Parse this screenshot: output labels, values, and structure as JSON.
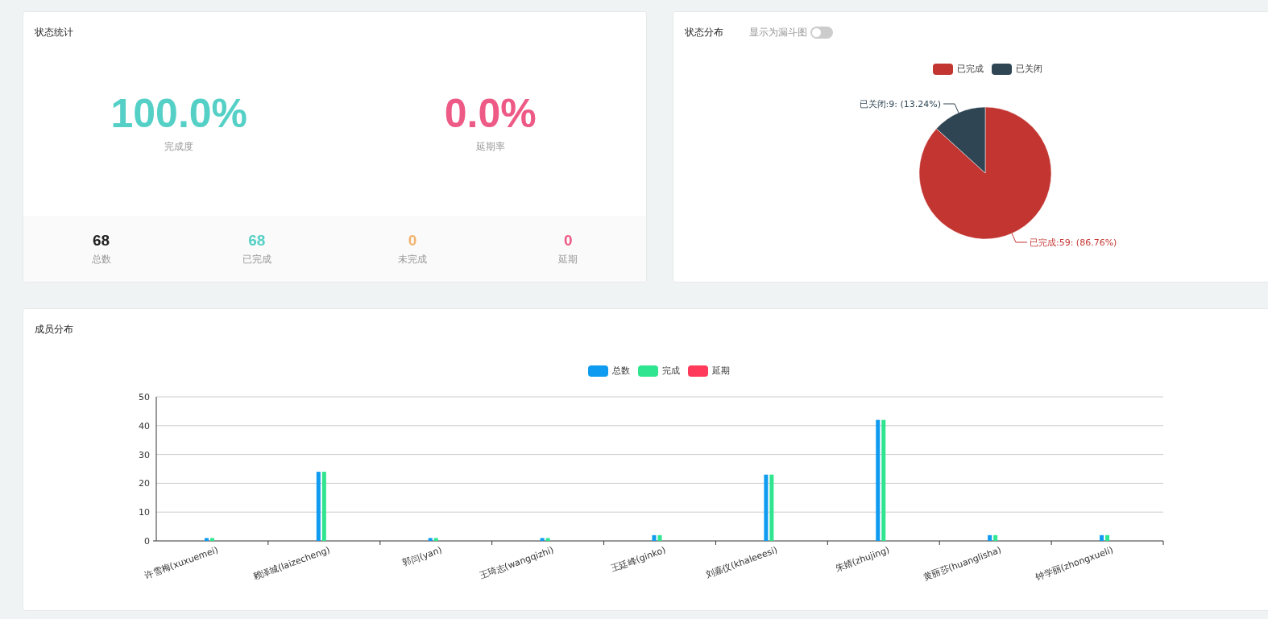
{
  "status_stats": {
    "title": "状态统计",
    "metrics": [
      {
        "value": "100.0%",
        "label": "完成度",
        "kind": "good"
      },
      {
        "value": "0.0%",
        "label": "延期率",
        "kind": "bad"
      }
    ],
    "totals": [
      {
        "value": "68",
        "label": "总数",
        "color": "#222222"
      },
      {
        "value": "68",
        "label": "已完成",
        "color": "#55d0c6"
      },
      {
        "value": "0",
        "label": "未完成",
        "color": "#f2b36f"
      },
      {
        "value": "0",
        "label": "延期",
        "color": "#ee5a86"
      }
    ]
  },
  "status_distribution": {
    "title": "状态分布",
    "funnel_toggle": {
      "label": "显示为漏斗图",
      "on": false
    },
    "chart_data": {
      "type": "pie",
      "categories": [
        "已完成",
        "已关闭"
      ],
      "values": [
        59,
        9
      ],
      "colors": [
        "#c23531",
        "#2f4554"
      ],
      "legend": "top",
      "value_labels": [
        "已完成:59: (86.76%)",
        "已关闭:9: (13.24%)"
      ]
    }
  },
  "member_distribution": {
    "title": "成员分布",
    "chart_data": {
      "type": "bar",
      "categories": [
        "许雪梅(xuxuemei)",
        "赖泽城(laizecheng)",
        "郭闫(yan)",
        "王琦志(wangqizhi)",
        "王廷峰(ginko)",
        "刘嘉仪(khaleeesi)",
        "朱婧(zhujing)",
        "黄丽莎(huanglisha)",
        "钟学丽(zhongxueli)"
      ],
      "series": [
        {
          "name": "总数",
          "color": "#0f9bf0",
          "values": [
            1,
            24,
            1,
            1,
            2,
            23,
            42,
            2,
            2
          ]
        },
        {
          "name": "完成",
          "color": "#2fe58f",
          "values": [
            1,
            24,
            1,
            1,
            2,
            23,
            42,
            2,
            2
          ]
        },
        {
          "name": "延期",
          "color": "#ff3a5a",
          "values": [
            0,
            0,
            0,
            0,
            0,
            0,
            0,
            0,
            0
          ]
        }
      ],
      "ylim": [
        0,
        50
      ],
      "grid": true,
      "legend": "top",
      "yticks": [
        0,
        10,
        20,
        30,
        40,
        50
      ]
    }
  }
}
